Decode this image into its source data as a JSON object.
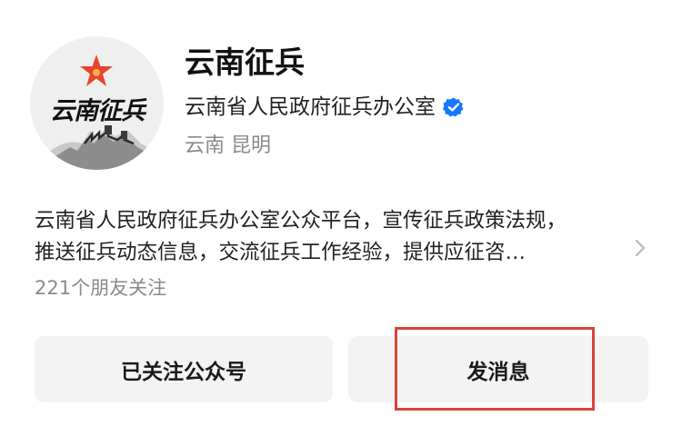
{
  "profile": {
    "avatar_text": "云南征兵",
    "name": "云南征兵",
    "organization": "云南省人民政府征兵办公室",
    "verified_icon": "verified-check-icon",
    "location": "云南 昆明",
    "description_line1": "云南省人民政府征兵办公室公众平台，宣传征兵政策法规，",
    "description_line2": "推送征兵动态信息，交流征兵工作经验，提供应征咨…",
    "followers": "221个朋友关注"
  },
  "actions": {
    "follow_label": "已关注公众号",
    "message_label": "发消息"
  },
  "colors": {
    "verified": "#1677ff",
    "star": "#e8442a",
    "highlight": "#d9443a",
    "button_bg": "#f3f3f3",
    "muted_text": "#8a8a8a"
  }
}
